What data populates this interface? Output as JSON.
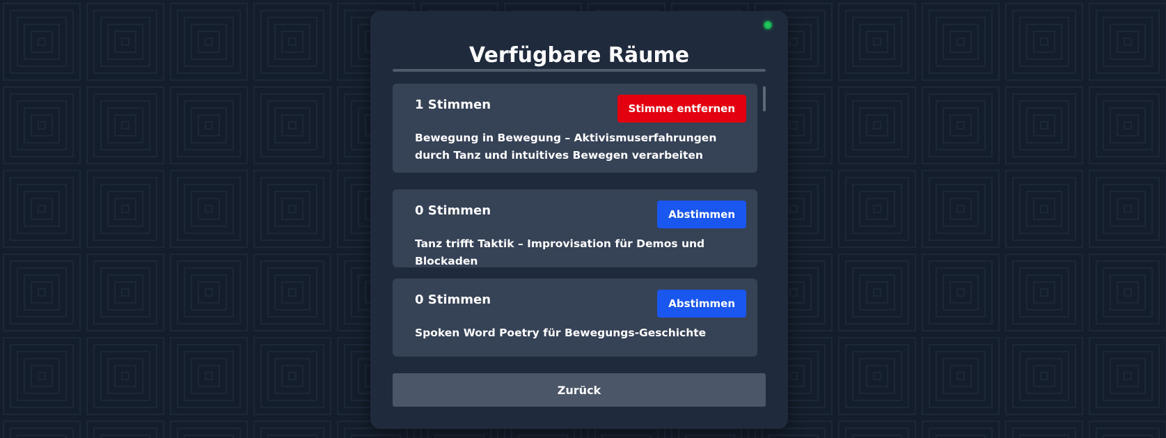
{
  "colors": {
    "background": "#141d2b",
    "panel": "#1f2a3c",
    "card": "#364256",
    "remove_button": "#e3000f",
    "vote_button": "#1a56f0",
    "back_button": "#4b5668",
    "status_online": "#22c55e"
  },
  "panel": {
    "title": "Verfügbare Räume",
    "status_icon": "online-status-dot"
  },
  "rooms": [
    {
      "votes": "1 Stimmen",
      "button_label": "Stimme entfernen",
      "button_type": "remove",
      "description": "Bewegung in Bewegung – Aktivismuserfahrungen durch Tanz und intuitives Bewegen verarbeiten"
    },
    {
      "votes": "0 Stimmen",
      "button_label": "Abstimmen",
      "button_type": "vote",
      "description": "Tanz trifft Taktik – Improvisation für Demos und Blockaden"
    },
    {
      "votes": "0 Stimmen",
      "button_label": "Abstimmen",
      "button_type": "vote",
      "description": "Spoken Word Poetry für Bewegungs-Geschichte"
    }
  ],
  "footer": {
    "back_label": "Zurück"
  }
}
